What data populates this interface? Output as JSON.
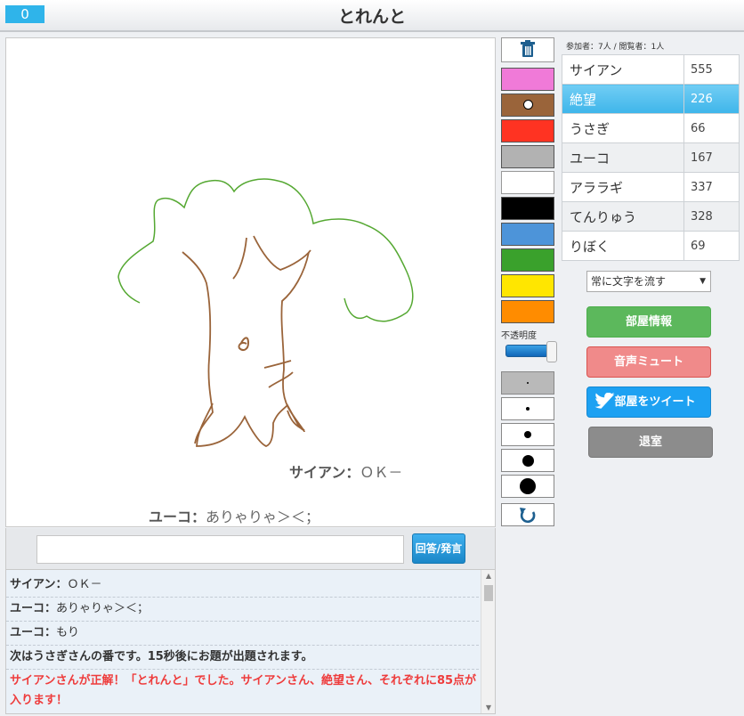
{
  "header": {
    "timer": "0",
    "title": "とれんと"
  },
  "canvas": {
    "bubbles": [
      {
        "name": "サイアン",
        "sep": "：",
        "text": "ＯＫ－"
      },
      {
        "name": "ユーコ",
        "sep": "：",
        "text": "ありゃりゃ＞＜；"
      }
    ]
  },
  "input": {
    "placeholder": "",
    "button_label": "回答/発言"
  },
  "chat": {
    "messages": [
      {
        "name": "サイアン",
        "sep": "：",
        "text": "ＯＫ－"
      },
      {
        "name": "ユーコ",
        "sep": "：",
        "text": "ありゃりゃ＞＜；"
      },
      {
        "name": "ユーコ",
        "sep": "：",
        "text": "もり"
      },
      {
        "text": "次はうさぎさんの番です。15秒後にお題が出題されます。"
      },
      {
        "text": "サイアンさんが正解！「とれんと」でした。サイアンさん、絶望さん、それぞれに85点が入ります！"
      }
    ]
  },
  "tools": {
    "trash_icon": "trash-icon",
    "colors": [
      "#f07ad8",
      "#9a643a",
      "#ff3322",
      "#b2b2b2",
      "#ffffff",
      "#000000",
      "#4d94d9",
      "#3aa12c",
      "#ffe600",
      "#ff8c00"
    ],
    "selected_color_index": 1,
    "opacity_label": "不透明度",
    "opacity_value": 1.0,
    "brush_sizes": [
      2,
      4,
      8,
      13,
      18
    ],
    "selected_size_index": 0,
    "undo_icon": "undo-icon"
  },
  "room": {
    "participants_label": "参加者：7人 / 閲覧者：1人"
  },
  "scoreboard": [
    {
      "name": "サイアン",
      "score": "555"
    },
    {
      "name": "絶望",
      "score": "226",
      "active": true
    },
    {
      "name": "うさぎ",
      "score": "66"
    },
    {
      "name": "ユーコ",
      "score": "167"
    },
    {
      "name": "アララギ",
      "score": "337"
    },
    {
      "name": "てんりゅう",
      "score": "328"
    },
    {
      "name": "りぼく",
      "score": "69"
    }
  ],
  "controls": {
    "flow_select": "常に文字を流す",
    "room_info": "部屋情報",
    "mute": "音声ミュート",
    "tweet": "部屋をツイート",
    "leave": "退室"
  }
}
